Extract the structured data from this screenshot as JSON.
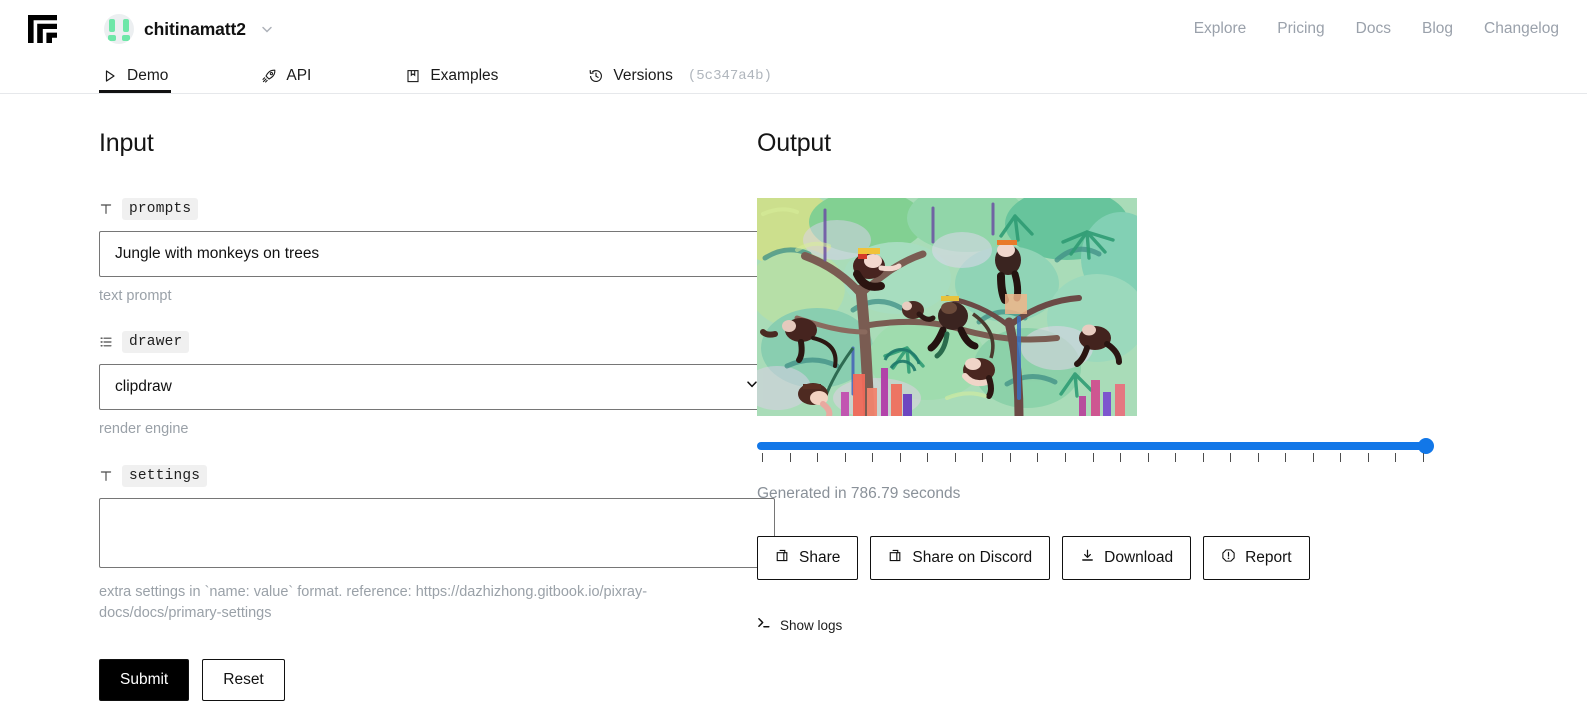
{
  "header": {
    "logo_icon": "replicate-logo",
    "account": {
      "name": "chitinamatt2",
      "avatar_icon": "user-avatar",
      "chevron_icon": "chevron-down-icon"
    },
    "nav": [
      {
        "label": "Explore"
      },
      {
        "label": "Pricing"
      },
      {
        "label": "Docs"
      },
      {
        "label": "Blog"
      },
      {
        "label": "Changelog"
      }
    ]
  },
  "tabs": [
    {
      "label": "Demo",
      "icon": "play-triangle-icon",
      "active": true
    },
    {
      "label": "API",
      "icon": "rocket-icon",
      "active": false
    },
    {
      "label": "Examples",
      "icon": "book-icon",
      "active": false
    },
    {
      "label": "Versions",
      "icon": "history-clock-icon",
      "active": false,
      "hash": "(5c347a4b)"
    }
  ],
  "input": {
    "title": "Input",
    "fields": [
      {
        "name": "prompts",
        "type_icon": "text-type-icon",
        "value": "Jungle with monkeys on trees",
        "placeholder": "",
        "help": "text prompt"
      },
      {
        "name": "drawer",
        "type_icon": "list-type-icon",
        "value": "clipdraw",
        "options": [
          "clipdraw"
        ],
        "help": "render engine"
      },
      {
        "name": "settings",
        "type_icon": "text-type-icon",
        "value": "",
        "placeholder": "",
        "help": "extra settings in `name: value` format. reference: https://dazhizhong.gitbook.io/pixray-docs/docs/primary-settings"
      }
    ],
    "submit_label": "Submit",
    "reset_label": "Reset"
  },
  "output": {
    "title": "Output",
    "image_alt": "Jungle with monkeys on trees — painterly clipdraw render",
    "slider": {
      "value_percent": 100,
      "tick_count": 25
    },
    "generated_text": "Generated in 786.79 seconds",
    "actions": [
      {
        "label": "Share",
        "icon": "copy-icon"
      },
      {
        "label": "Share on Discord",
        "icon": "copy-icon"
      },
      {
        "label": "Download",
        "icon": "download-icon"
      },
      {
        "label": "Report",
        "icon": "alert-octagon-icon"
      }
    ],
    "show_logs_label": "Show logs",
    "show_logs_icon": "terminal-prompt-icon"
  },
  "colors": {
    "accent_blue": "#1277e8",
    "avatar_green": "#6ee7a8",
    "muted_text": "#9aa1ab",
    "button_dark": "#000000"
  }
}
